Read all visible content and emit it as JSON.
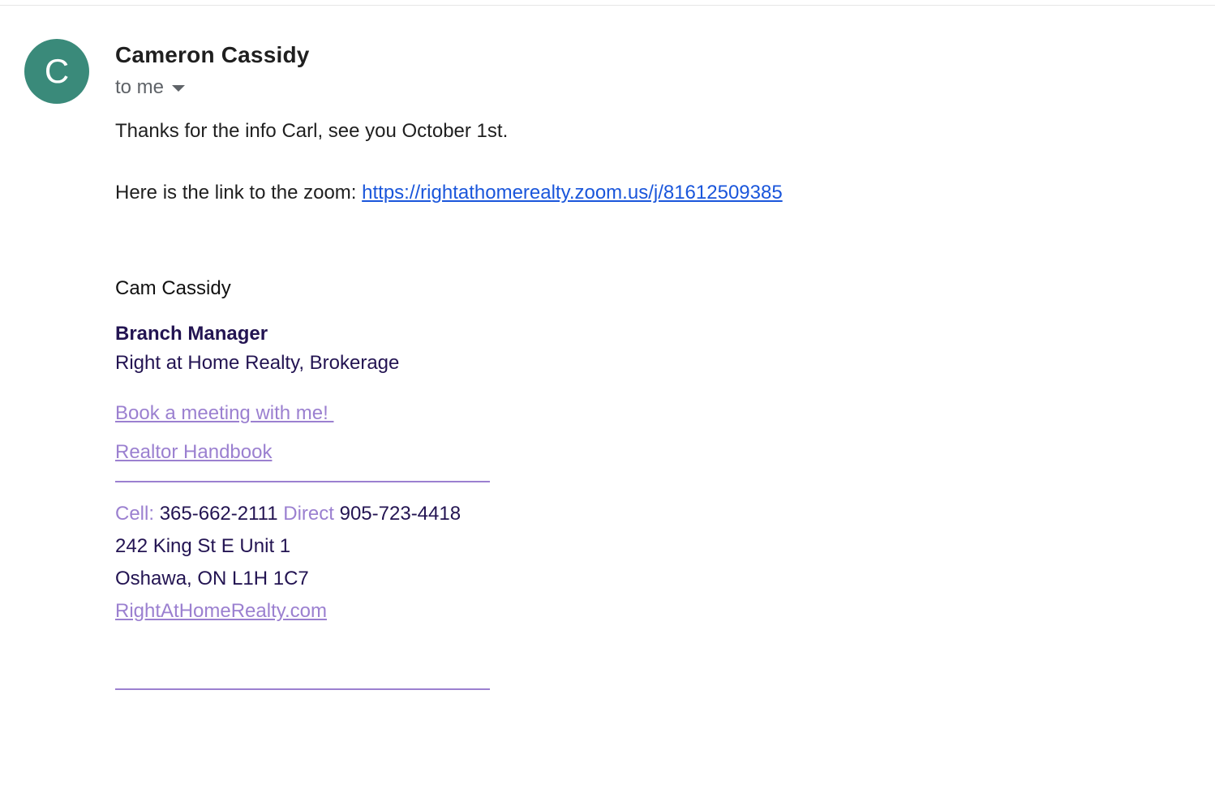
{
  "sender": {
    "initial": "C",
    "name": "Cameron Cassidy",
    "recipient": "to me",
    "avatar_color": "#3a8a7a"
  },
  "message": {
    "line1": "Thanks for the info Carl, see you October 1st.",
    "line2_prefix": "Here is the link to the zoom: ",
    "zoom_url": "https://rightathomerealty.zoom.us/j/81612509385"
  },
  "signature": {
    "name": "Cam Cassidy",
    "title": "Branch Manager",
    "company": "Right at Home Realty, Brokerage",
    "book_link": "Book a meeting with me! ",
    "handbook_link": "Realtor Handbook",
    "cell_label": "Cell:",
    "cell_number": "365-662-2111",
    "direct_label": "Direct",
    "direct_number": "905-723-4418",
    "address_line1": "242 King St E Unit 1",
    "address_line2": "Oshawa, ON L1H 1C7",
    "website": "RightAtHomeRealty.com",
    "accent_color": "#9b80d0",
    "text_color": "#231452"
  }
}
